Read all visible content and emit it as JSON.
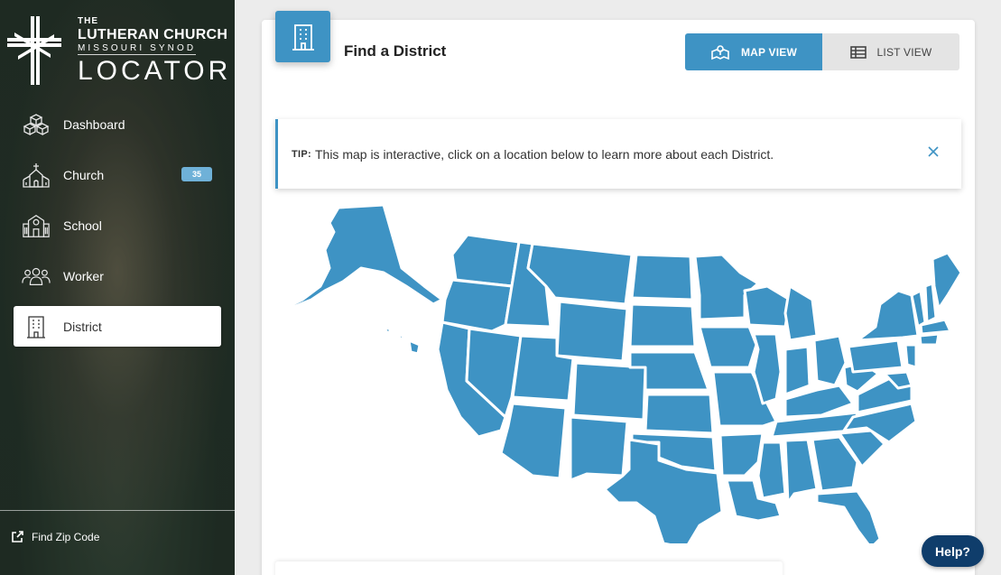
{
  "logo": {
    "line1": "THE",
    "line2": "LUTHERAN CHURCH",
    "line3": "MISSOURI SYNOD",
    "line4": "LOCATOR"
  },
  "nav": {
    "items": [
      {
        "label": "Dashboard",
        "icon": "cubes-icon"
      },
      {
        "label": "Church",
        "icon": "church-icon",
        "badge": "35"
      },
      {
        "label": "School",
        "icon": "school-icon"
      },
      {
        "label": "Worker",
        "icon": "users-icon"
      },
      {
        "label": "District",
        "icon": "building-icon",
        "active": true
      }
    ]
  },
  "footer": {
    "find_zip_label": "Find Zip Code"
  },
  "main": {
    "title": "Find a District",
    "view_toggle": {
      "map_label": "MAP VIEW",
      "list_label": "LIST VIEW",
      "selected": "map"
    },
    "tip": {
      "prefix": "TIP:",
      "text": "This map is interactive, click on a location below to learn more about each District."
    }
  },
  "help_label": "Help?",
  "colors": {
    "accent": "#3e93c4",
    "help_button": "#0f3d6b",
    "badge": "#6fb1d8"
  }
}
